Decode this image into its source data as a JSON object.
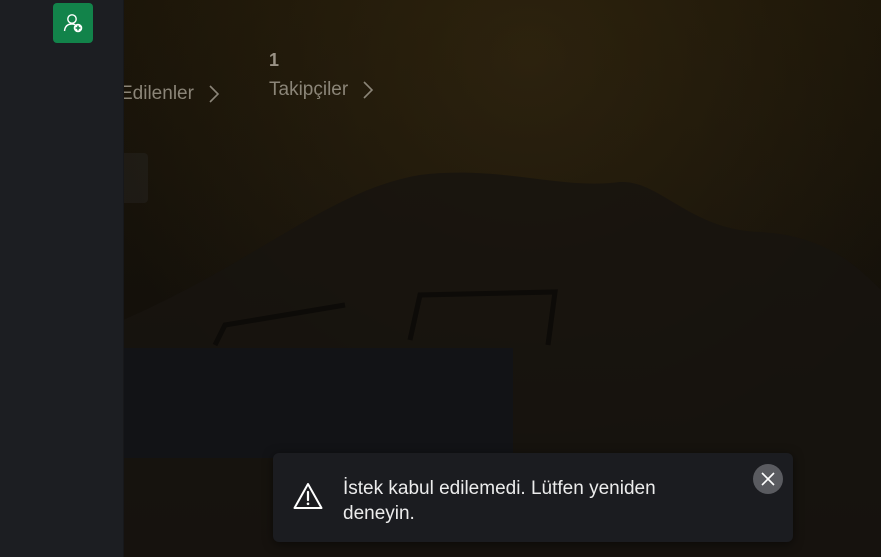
{
  "stats": {
    "following": {
      "label": "Edilenler"
    },
    "followers": {
      "count": "1",
      "label": "Takipçiler"
    }
  },
  "sidebar": {
    "add_friend_icon": "add-user-icon",
    "accent": "#12834a"
  },
  "toast": {
    "icon": "warning-icon",
    "message": "İstek kabul edilemedi. Lütfen yeniden deneyin.",
    "close_icon": "close-icon"
  }
}
